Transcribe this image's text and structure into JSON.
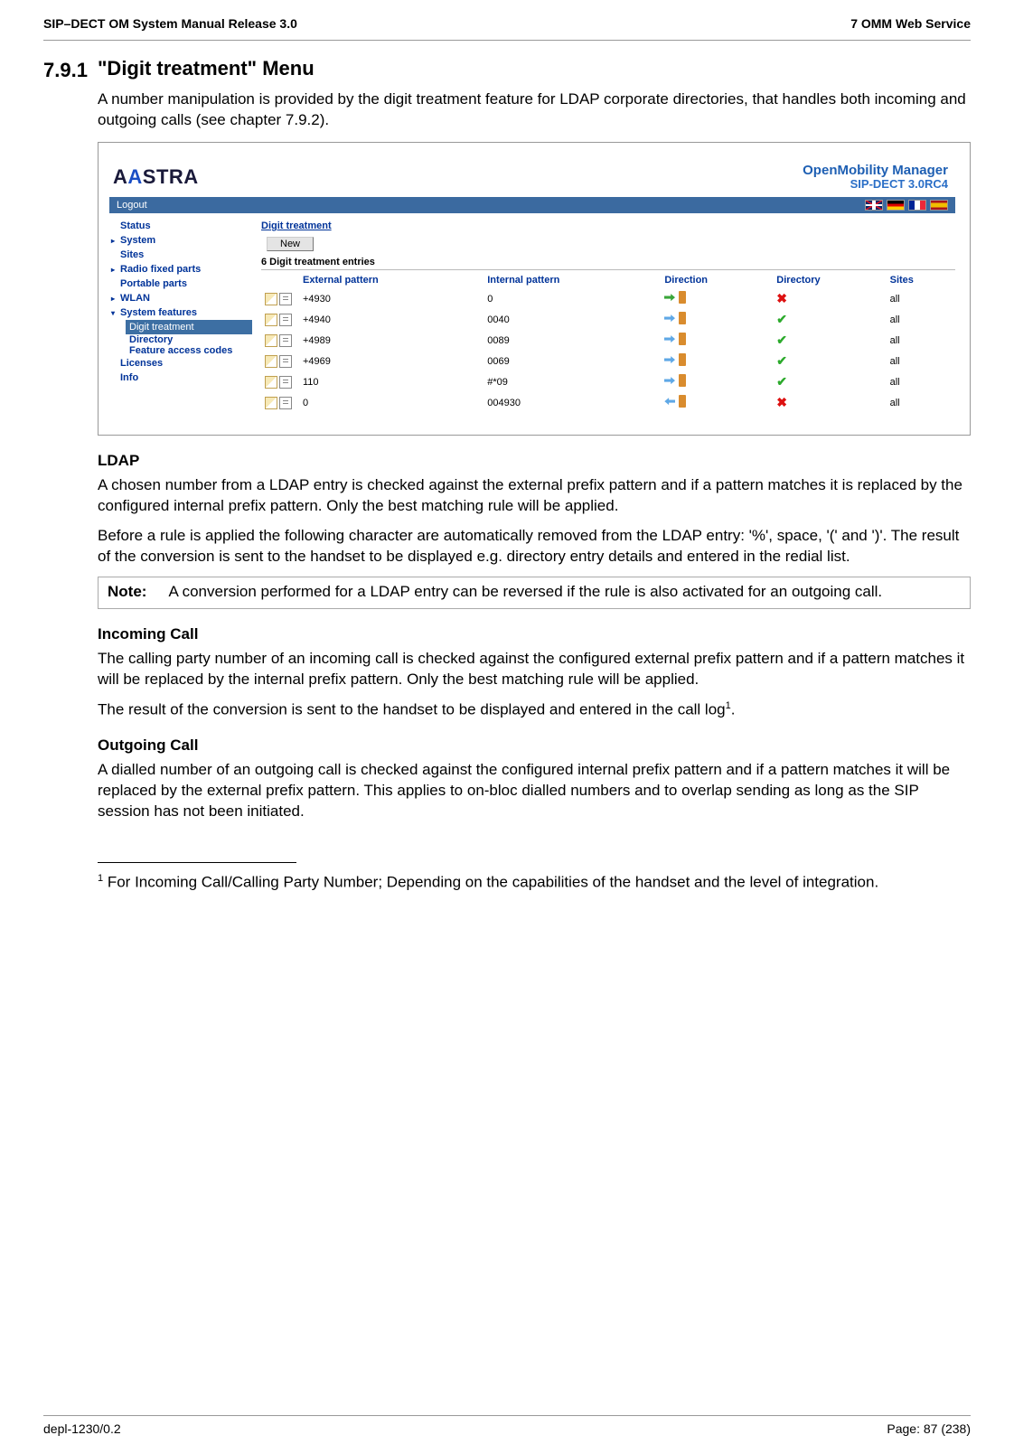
{
  "header": {
    "left": "SIP–DECT OM System Manual Release 3.0",
    "right": "7 OMM Web Service"
  },
  "section": {
    "num": "7.9.1",
    "title": "\"Digit treatment\" Menu"
  },
  "intro": "A number manipulation is provided by the digit treatment feature for LDAP corporate directories, that handles both incoming and outgoing calls (see chapter 7.9.2).",
  "ui": {
    "brand": {
      "logo_pre": "A",
      "logo_mid": "A",
      "logo_post": "STRA",
      "title": "OpenMobility Manager",
      "sub": "SIP-DECT 3.0RC4"
    },
    "logout": "Logout",
    "nav": {
      "status": "Status",
      "system": "System",
      "sites": "Sites",
      "rfp": "Radio fixed parts",
      "pp": "Portable parts",
      "wlan": "WLAN",
      "sysfeat": "System features",
      "digit": "Digit treatment",
      "directory": "Directory",
      "fac": "Feature access codes",
      "lic": "Licenses",
      "info": "Info"
    },
    "crumb": "Digit treatment",
    "new_btn": "New",
    "tbl_title": "6 Digit treatment entries",
    "cols": {
      "ext": "External pattern",
      "int": "Internal pattern",
      "dir": "Direction",
      "dct": "Directory",
      "sites": "Sites"
    },
    "rows": [
      {
        "ext": "+4930",
        "int": "0",
        "dir": "out",
        "dct": "x",
        "sites": "all"
      },
      {
        "ext": "+4940",
        "int": "0040",
        "dir": "both",
        "dct": "ok",
        "sites": "all"
      },
      {
        "ext": "+4989",
        "int": "0089",
        "dir": "both",
        "dct": "ok",
        "sites": "all"
      },
      {
        "ext": "+4969",
        "int": "0069",
        "dir": "both",
        "dct": "ok",
        "sites": "all"
      },
      {
        "ext": "110",
        "int": "#*09",
        "dir": "both",
        "dct": "ok",
        "sites": "all"
      },
      {
        "ext": "0",
        "int": "004930",
        "dir": "in",
        "dct": "x",
        "sites": "all"
      }
    ]
  },
  "ldap": {
    "h": "LDAP",
    "p1": "A chosen number from a LDAP entry is checked against the external prefix pattern and if a pattern matches it is replaced by the configured internal prefix pattern. Only the best matching rule will be applied.",
    "p2": "Before a rule is applied the following character are automatically removed from the LDAP entry: '%', space, '(' and ')'. The result of the conversion is sent to the handset to be displayed e.g. directory entry details and entered in the redial list."
  },
  "note": {
    "label": "Note:",
    "text": "A conversion performed for a LDAP entry can be reversed if the rule is also activated for an outgoing call."
  },
  "inc": {
    "h": "Incoming Call",
    "p1": "The calling party number of an incoming call is checked against the configured external prefix pattern and if a pattern matches it will be replaced by the internal prefix pattern. Only the best matching rule will be applied.",
    "p2a": "The result of the conversion is sent to the handset to be displayed and entered in the call log",
    "p2b": "."
  },
  "out": {
    "h": "Outgoing Call",
    "p": "A dialled number of an outgoing call is checked against the configured internal prefix pattern and if a pattern matches it will be replaced by the external prefix pattern. This applies to on-bloc dialled numbers and to overlap sending as long as the SIP session has not been initiated."
  },
  "fn": {
    "mark": "1",
    "text": " For Incoming Call/Calling Party Number; Depending on the capabilities of the handset and the level of integration."
  },
  "footer": {
    "left": "depl-1230/0.2",
    "right": "Page: 87 (238)"
  }
}
